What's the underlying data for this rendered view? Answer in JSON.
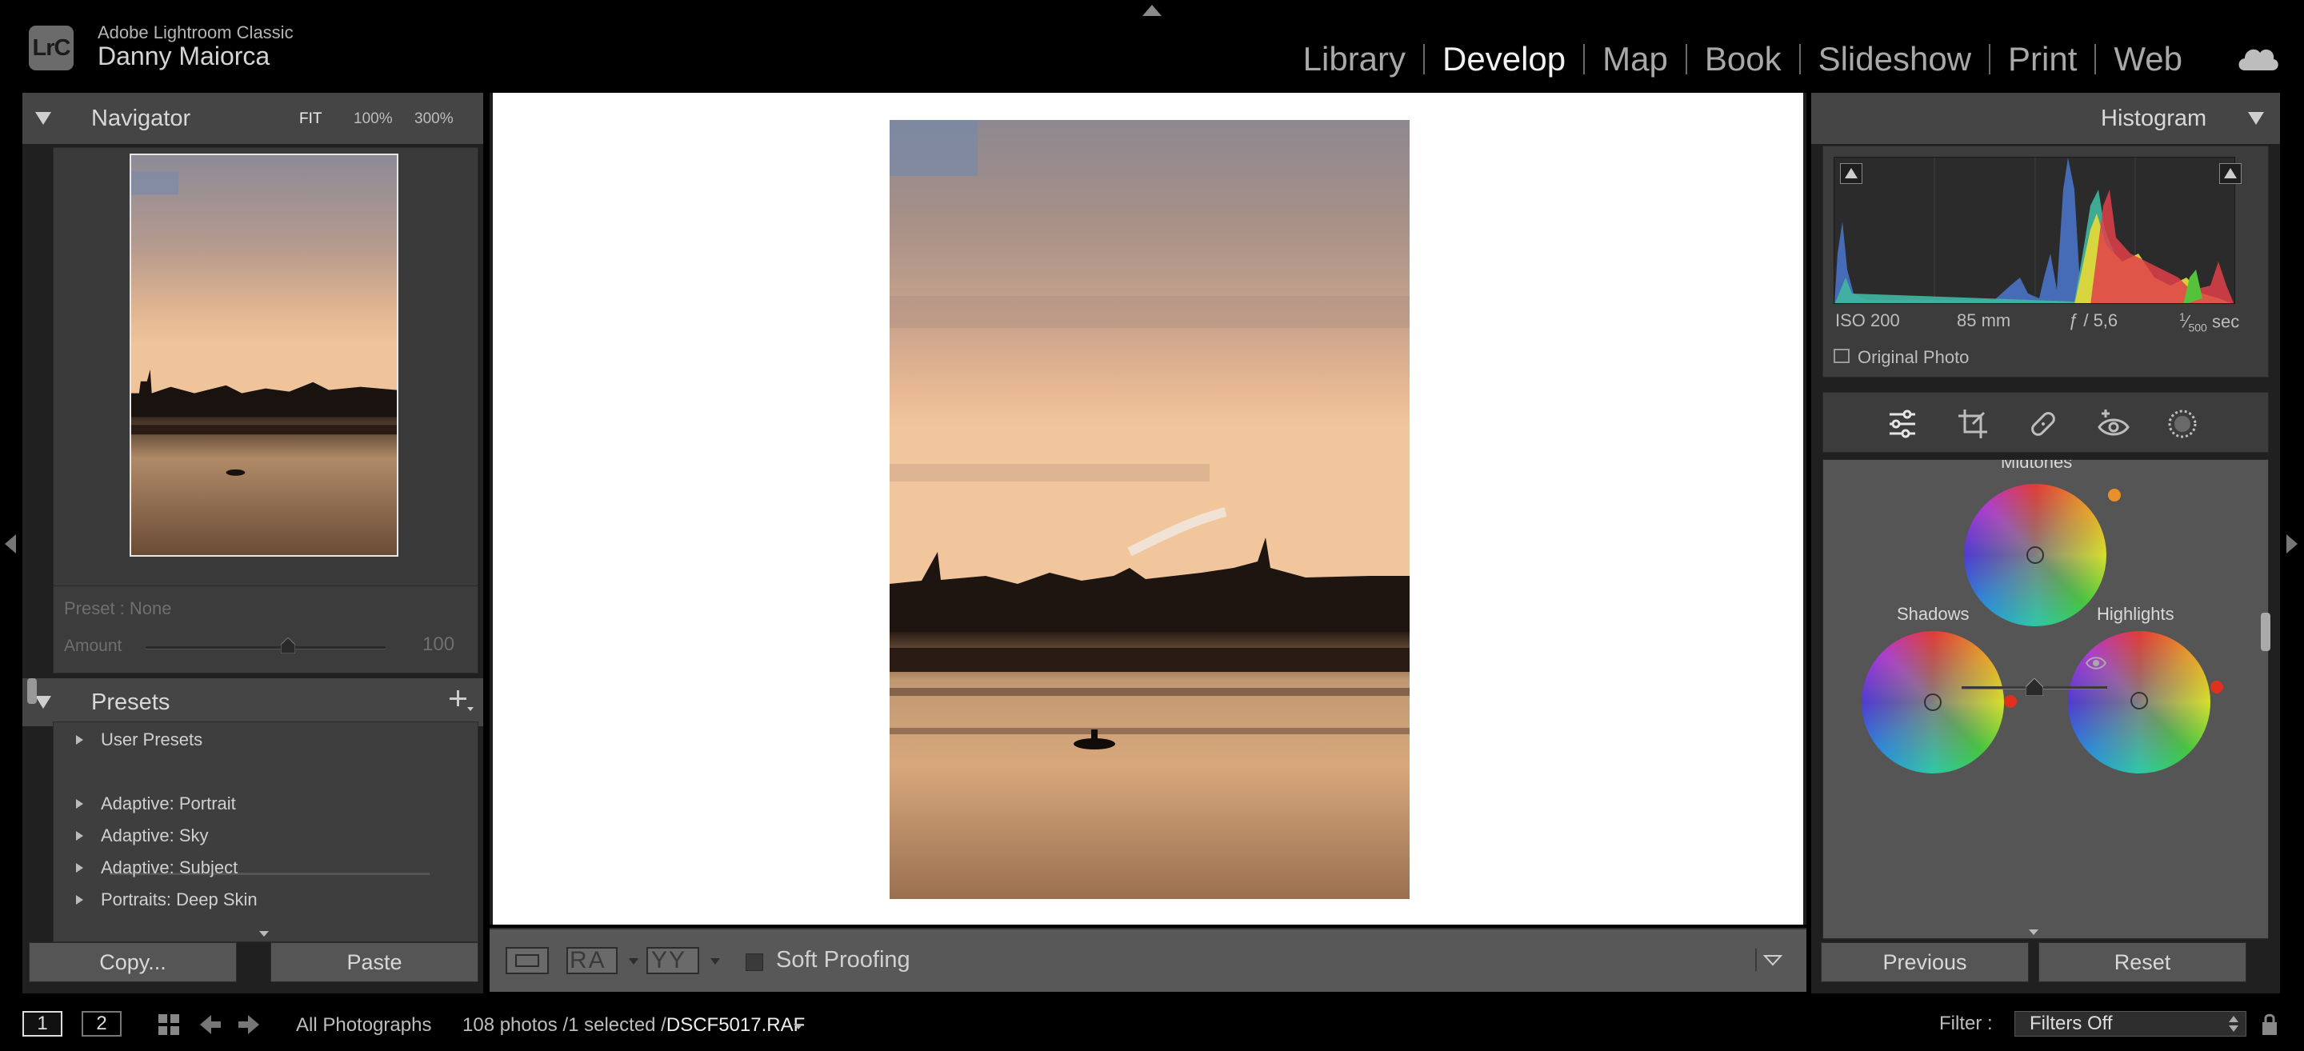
{
  "app": {
    "logo": "LrC",
    "name": "Adobe Lightroom Classic",
    "user": "Danny Maiorca"
  },
  "modules": [
    "Library",
    "Develop",
    "Map",
    "Book",
    "Slideshow",
    "Print",
    "Web"
  ],
  "active_module": "Develop",
  "navigator": {
    "title": "Navigator",
    "zoom_fit": "FIT",
    "zoom_100": "100%",
    "zoom_300": "300%"
  },
  "preset_amount": {
    "preset": "Preset : None",
    "amount_label": "Amount",
    "amount_value": "100",
    "amount_fraction": 0.5
  },
  "presets": {
    "title": "Presets",
    "items": [
      "User Presets",
      "Adaptive: Portrait",
      "Adaptive: Sky",
      "Adaptive: Subject",
      "Portraits: Deep Skin"
    ]
  },
  "left_buttons": {
    "copy": "Copy...",
    "paste": "Paste"
  },
  "toolbar": {
    "ra": "RA",
    "yy": "YY",
    "soft_proofing": "Soft Proofing"
  },
  "histogram": {
    "title": "Histogram",
    "iso": "ISO 200",
    "focal": "85 mm",
    "aperture": "ƒ / 5,6",
    "shutter_num": "1",
    "shutter_den": "500",
    "shutter_unit": "sec",
    "original_photo": "Original Photo"
  },
  "color_grading": {
    "midtones": "Midtones",
    "shadows": "Shadows",
    "highlights": "Highlights",
    "blend_fraction": 0.5
  },
  "right_buttons": {
    "previous": "Previous",
    "reset": "Reset"
  },
  "filmstrip": {
    "page1": "1",
    "page2": "2",
    "source": "All Photographs",
    "count": "108 photos /1 selected /",
    "file": "DSCF5017.RAF",
    "filter_label": "Filter :",
    "filter_value": "Filters Off"
  },
  "colors": {
    "accent_orange": "#e8902a",
    "accent_red": "#e0301e"
  },
  "icons": [
    "cloud-icon",
    "sliders-icon",
    "crop-icon",
    "healing-icon",
    "redeye-icon",
    "masking-icon",
    "eye-icon",
    "grid-icon",
    "add-icon"
  ]
}
